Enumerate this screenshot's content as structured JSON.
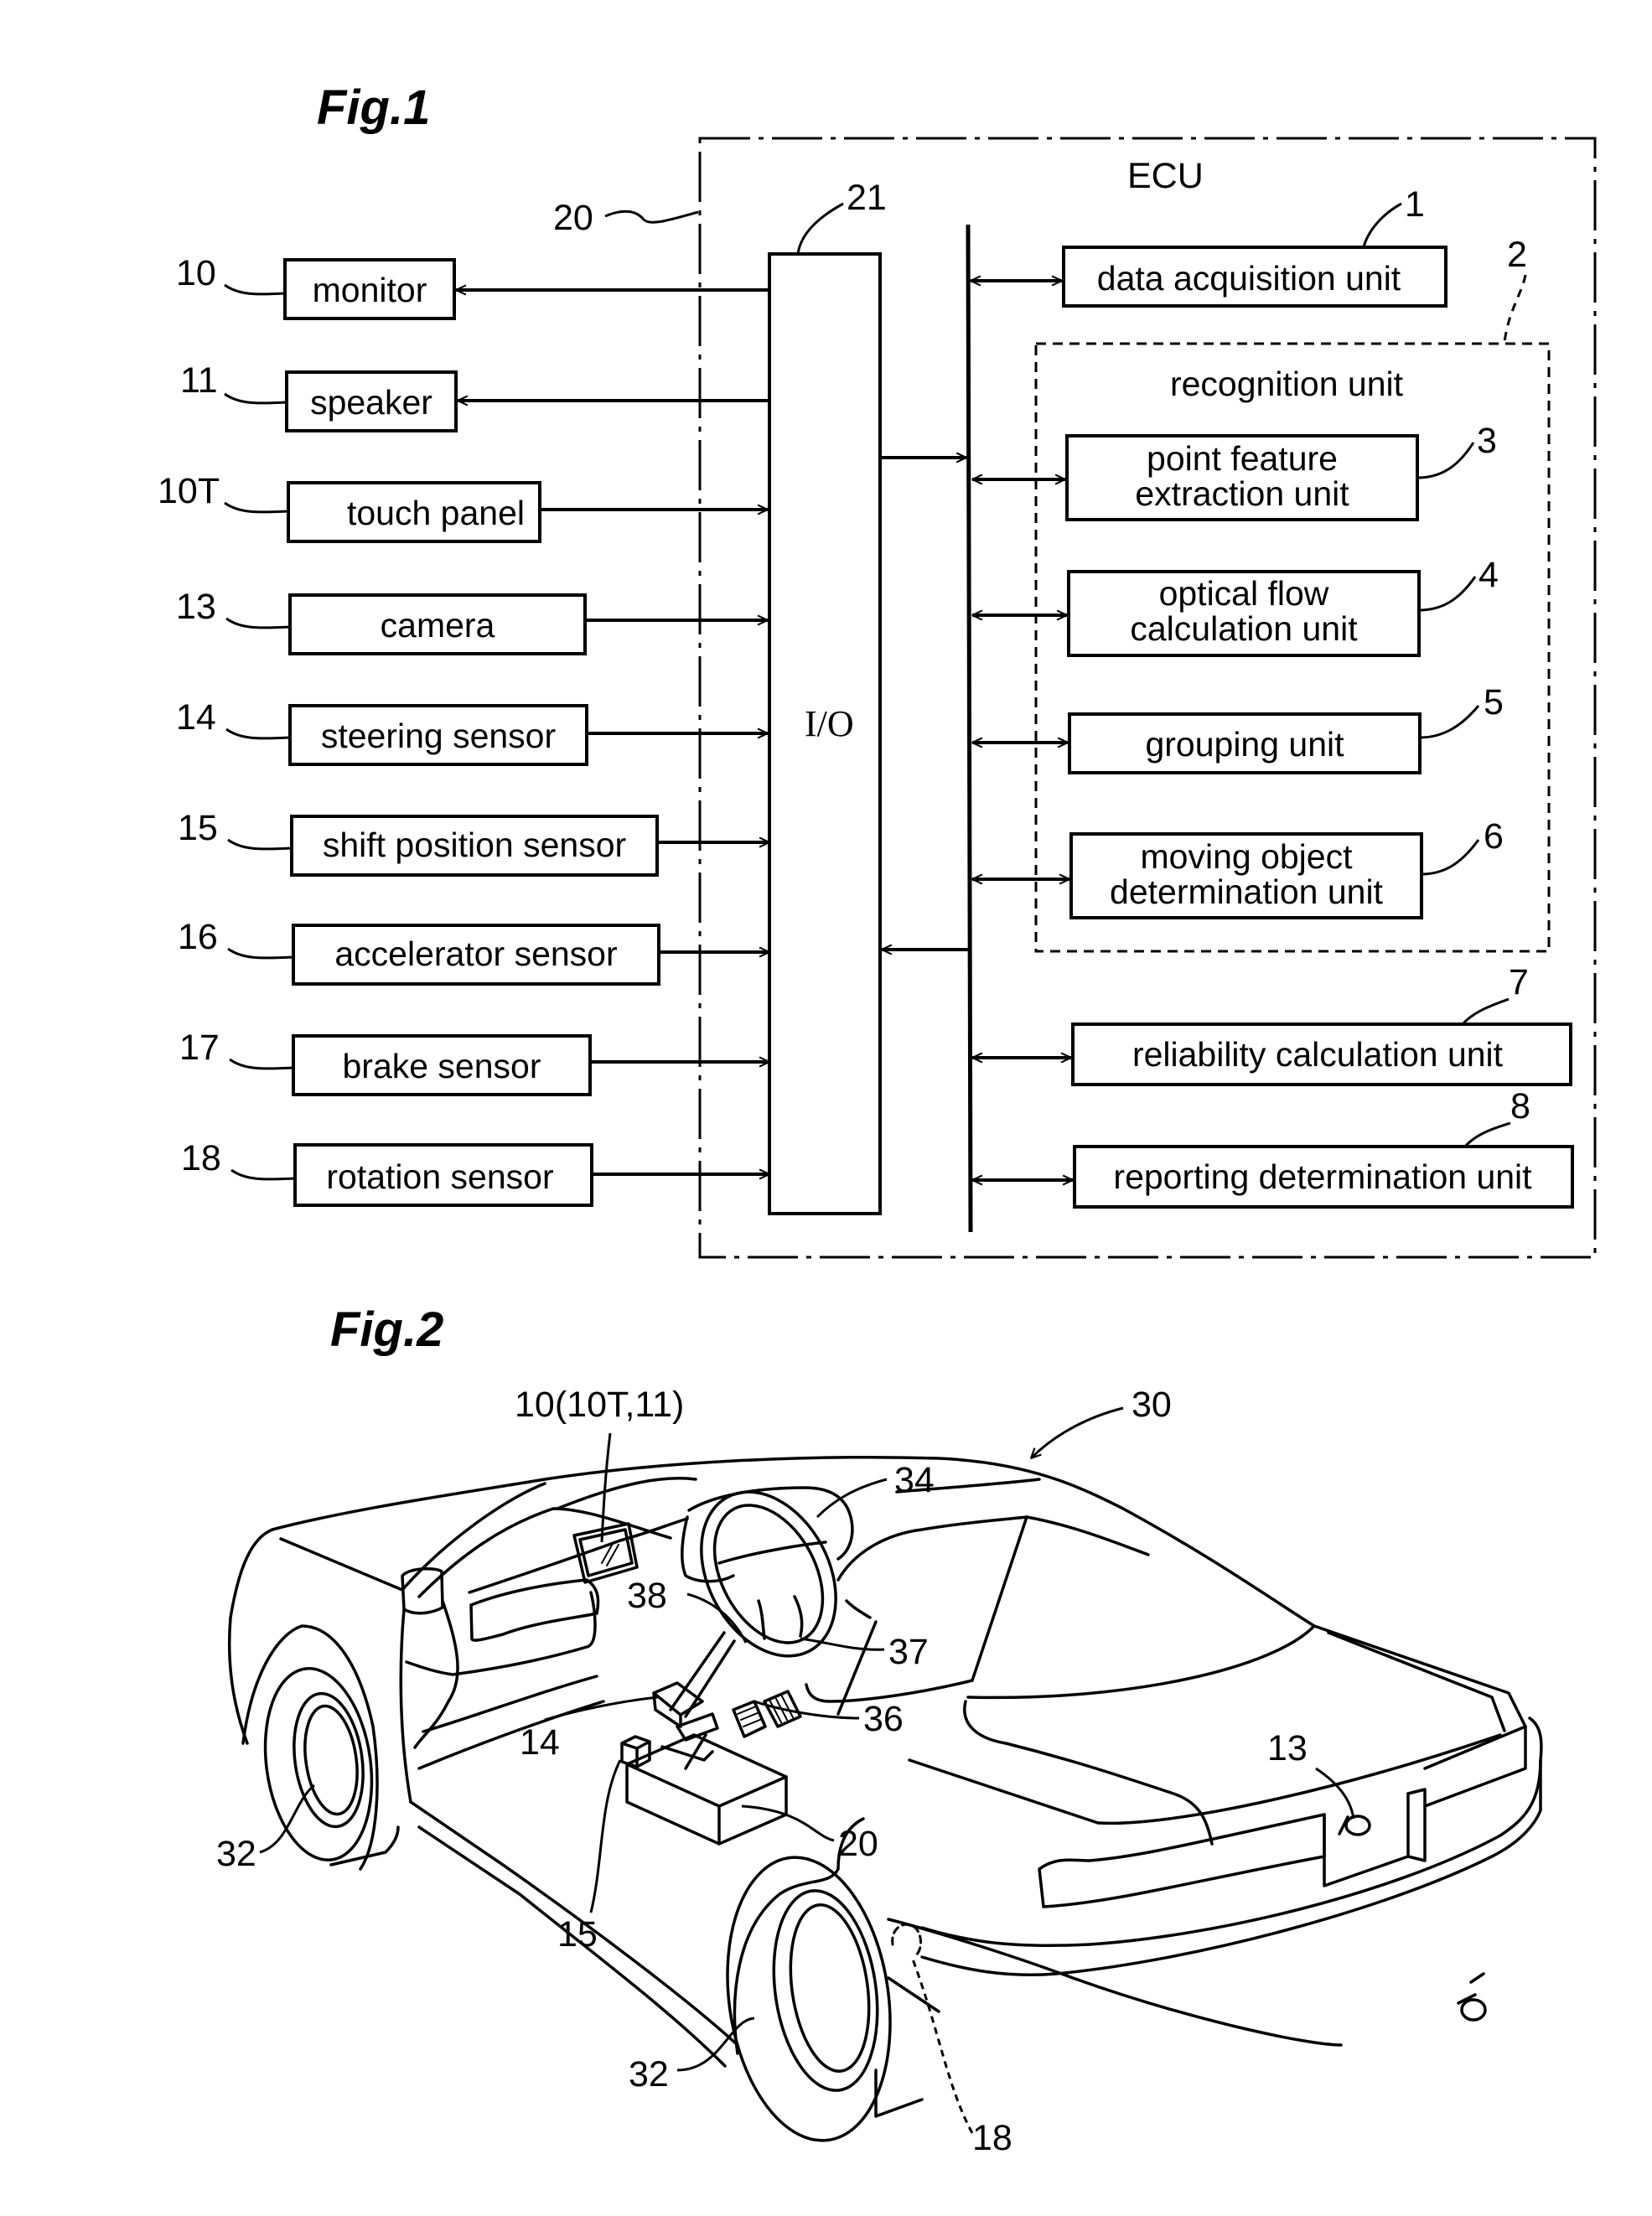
{
  "figure1": {
    "title": "Fig.1",
    "ecu": {
      "label": "ECU",
      "ref": "20"
    },
    "io_block": {
      "label": "I/O",
      "ref": "21"
    },
    "outputs": [
      {
        "ref": "10",
        "label": "monitor"
      },
      {
        "ref": "11",
        "label": "speaker"
      }
    ],
    "inputs": [
      {
        "ref": "10T",
        "label": "touch panel"
      },
      {
        "ref": "13",
        "label": "camera"
      },
      {
        "ref": "14",
        "label": "steering sensor"
      },
      {
        "ref": "15",
        "label": "shift position sensor"
      },
      {
        "ref": "16",
        "label": "accelerator sensor"
      },
      {
        "ref": "17",
        "label": "brake sensor"
      },
      {
        "ref": "18",
        "label": "rotation sensor"
      }
    ],
    "units": {
      "data_acquisition": {
        "ref": "1",
        "label": "data acquisition unit"
      },
      "recognition": {
        "ref": "2",
        "label": "recognition unit",
        "subunits": [
          {
            "ref": "3",
            "line1": "point feature",
            "line2": "extraction unit"
          },
          {
            "ref": "4",
            "line1": "optical flow",
            "line2": "calculation unit"
          },
          {
            "ref": "5",
            "line1": "grouping unit",
            "line2": ""
          },
          {
            "ref": "6",
            "line1": "moving object",
            "line2": "determination unit"
          }
        ]
      },
      "reliability": {
        "ref": "7",
        "label": "reliability calculation unit"
      },
      "reporting": {
        "ref": "8",
        "label": "reporting determination unit"
      }
    }
  },
  "figure2": {
    "title": "Fig.2",
    "labels": {
      "vehicle": "30",
      "monitor_group": "10(10T,11)",
      "steering_wheel": "34",
      "pedal_38": "38",
      "pedal_37": "37",
      "pedal_36": "36",
      "steering_sensor": "14",
      "shift_sensor": "15",
      "ecu": "20",
      "camera": "13",
      "front_wheel": "32",
      "rear_wheel": "32",
      "rotation_sensor": "18"
    }
  }
}
